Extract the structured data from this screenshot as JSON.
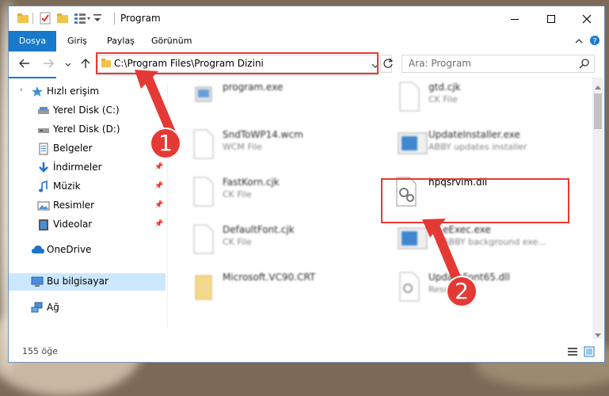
{
  "window": {
    "title": "Program"
  },
  "ribbon": {
    "tabs": [
      "Dosya",
      "Giriş",
      "Paylaş",
      "Görünüm"
    ]
  },
  "navigation": {
    "address": "C:\\Program Files\\Program Dizini",
    "search_placeholder": "Ara: Program"
  },
  "sidebar": {
    "items": [
      {
        "label": "Hızlı erişim",
        "icon": "star-icon"
      },
      {
        "label": "Yerel Disk (C:)",
        "icon": "drive-icon"
      },
      {
        "label": "Yerel Disk (D:)",
        "icon": "drive-icon"
      },
      {
        "label": "Belgeler",
        "icon": "documents-icon"
      },
      {
        "label": "İndirmeler",
        "icon": "download-icon"
      },
      {
        "label": "Müzik",
        "icon": "music-icon"
      },
      {
        "label": "Resimler",
        "icon": "pictures-icon"
      },
      {
        "label": "Videolar",
        "icon": "videos-icon"
      },
      {
        "label": "OneDrive",
        "icon": "cloud-icon"
      },
      {
        "label": "Bu bilgisayar",
        "icon": "computer-icon"
      },
      {
        "label": "Ağ",
        "icon": "network-icon"
      }
    ]
  },
  "files": [
    {
      "name": "program.exe",
      "type": ""
    },
    {
      "name": "gtd.cjk",
      "type": "CK File"
    },
    {
      "name": "SndToWP14.wcm",
      "type": "WCM File"
    },
    {
      "name": "UpdateInstaller.exe",
      "type": "ABBY updates installer"
    },
    {
      "name": "FastKorn.cjk",
      "type": "CK File"
    },
    {
      "name": "hpqsrvim.dll",
      "type": ""
    },
    {
      "name": "DefaultFont.cjk",
      "type": "CK File"
    },
    {
      "name": "eExec.exe",
      "type": "ABBY background exe..."
    },
    {
      "name": "Microsoft.VC90.CRT",
      "type": ""
    },
    {
      "name": "UpdateFont65.dll",
      "type": "Reso...L"
    }
  ],
  "status": {
    "count": "155 öğe"
  },
  "annotations": {
    "step1": "1",
    "step2": "2"
  },
  "colors": {
    "accent": "#1979ca",
    "highlight": "#e53935",
    "selection": "#cce8ff"
  }
}
